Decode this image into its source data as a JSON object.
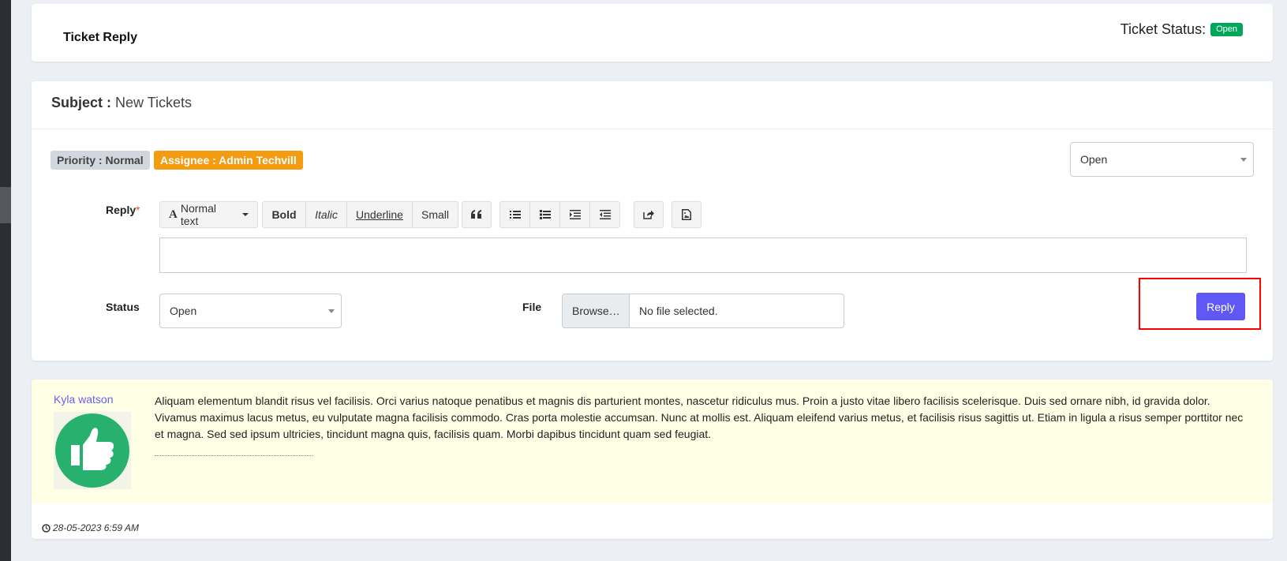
{
  "header": {
    "title": "Ticket Reply",
    "status_label": "Ticket Status:",
    "status_value": "Open"
  },
  "ticket": {
    "subject_label": "Subject :",
    "subject_value": "New Tickets",
    "priority": "Priority : Normal",
    "assignee": "Assignee : Admin Techvill",
    "status_select": "Open"
  },
  "form": {
    "reply_label": "Reply",
    "required_mark": "*",
    "toolbar": {
      "text_style": "Normal text",
      "bold": "Bold",
      "italic": "Italic",
      "underline": "Underline",
      "small": "Small"
    },
    "status_label": "Status",
    "status_value": "Open",
    "file_label": "File",
    "browse_label": "Browse…",
    "file_status": "No file selected.",
    "submit_label": "Reply"
  },
  "comments": [
    {
      "author": "Kyla watson",
      "text": "Aliquam elementum blandit risus vel facilisis. Orci varius natoque penatibus et magnis dis parturient montes, nascetur ridiculus mus. Proin a justo vitae libero facilisis scelerisque. Duis sed ornare nibh, id gravida dolor. Vivamus maximus lacus metus, eu vulputate magna facilisis commodo. Cras porta molestie accumsan. Nunc at mollis est. Aliquam eleifend varius metus, et facilisis risus sagittis ut. Etiam in ligula a risus semper porttitor nec et magna. Sed sed ipsum ultricies, tincidunt magna quis, facilisis quam. Morbi dapibus tincidunt quam sed feugiat.",
      "timestamp": "28-05-2023 6:59 AM"
    }
  ],
  "colors": {
    "status_open": "#00a65a",
    "assignee_badge": "#f39c12",
    "reply_button": "#6058f5",
    "highlight": "#ff0000",
    "comment_bg": "#ffffe5",
    "avatar": "#27b06e"
  }
}
